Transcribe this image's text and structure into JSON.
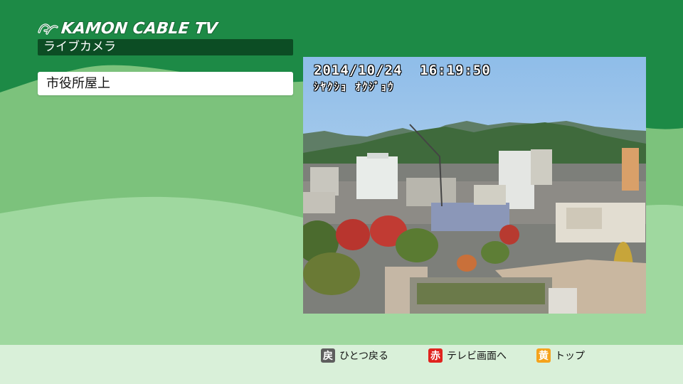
{
  "brand": {
    "logo_text": "KAMON CABLE TV"
  },
  "header": {
    "section_title": "ライブカメラ"
  },
  "camera_list": {
    "items": [
      {
        "label": "市役所屋上"
      }
    ]
  },
  "camera_view": {
    "timestamp": "2014/10/24  16:19:50",
    "location_caption": "ｼﾔｸｼｮ ｵｸｼﾞｮｳ"
  },
  "footer": {
    "back": {
      "key": "戻",
      "label": "ひとつ戻る"
    },
    "red": {
      "key": "赤",
      "label": "テレビ画面へ"
    },
    "yellow": {
      "key": "黄",
      "label": "トップ"
    }
  },
  "colors": {
    "dark_green": "#1d8a46",
    "mid_green": "#7fc37f",
    "light_green": "#a6dca6",
    "header_bar": "#0c4d24",
    "red_key": "#e0231e",
    "yellow_key": "#f5a31c"
  }
}
